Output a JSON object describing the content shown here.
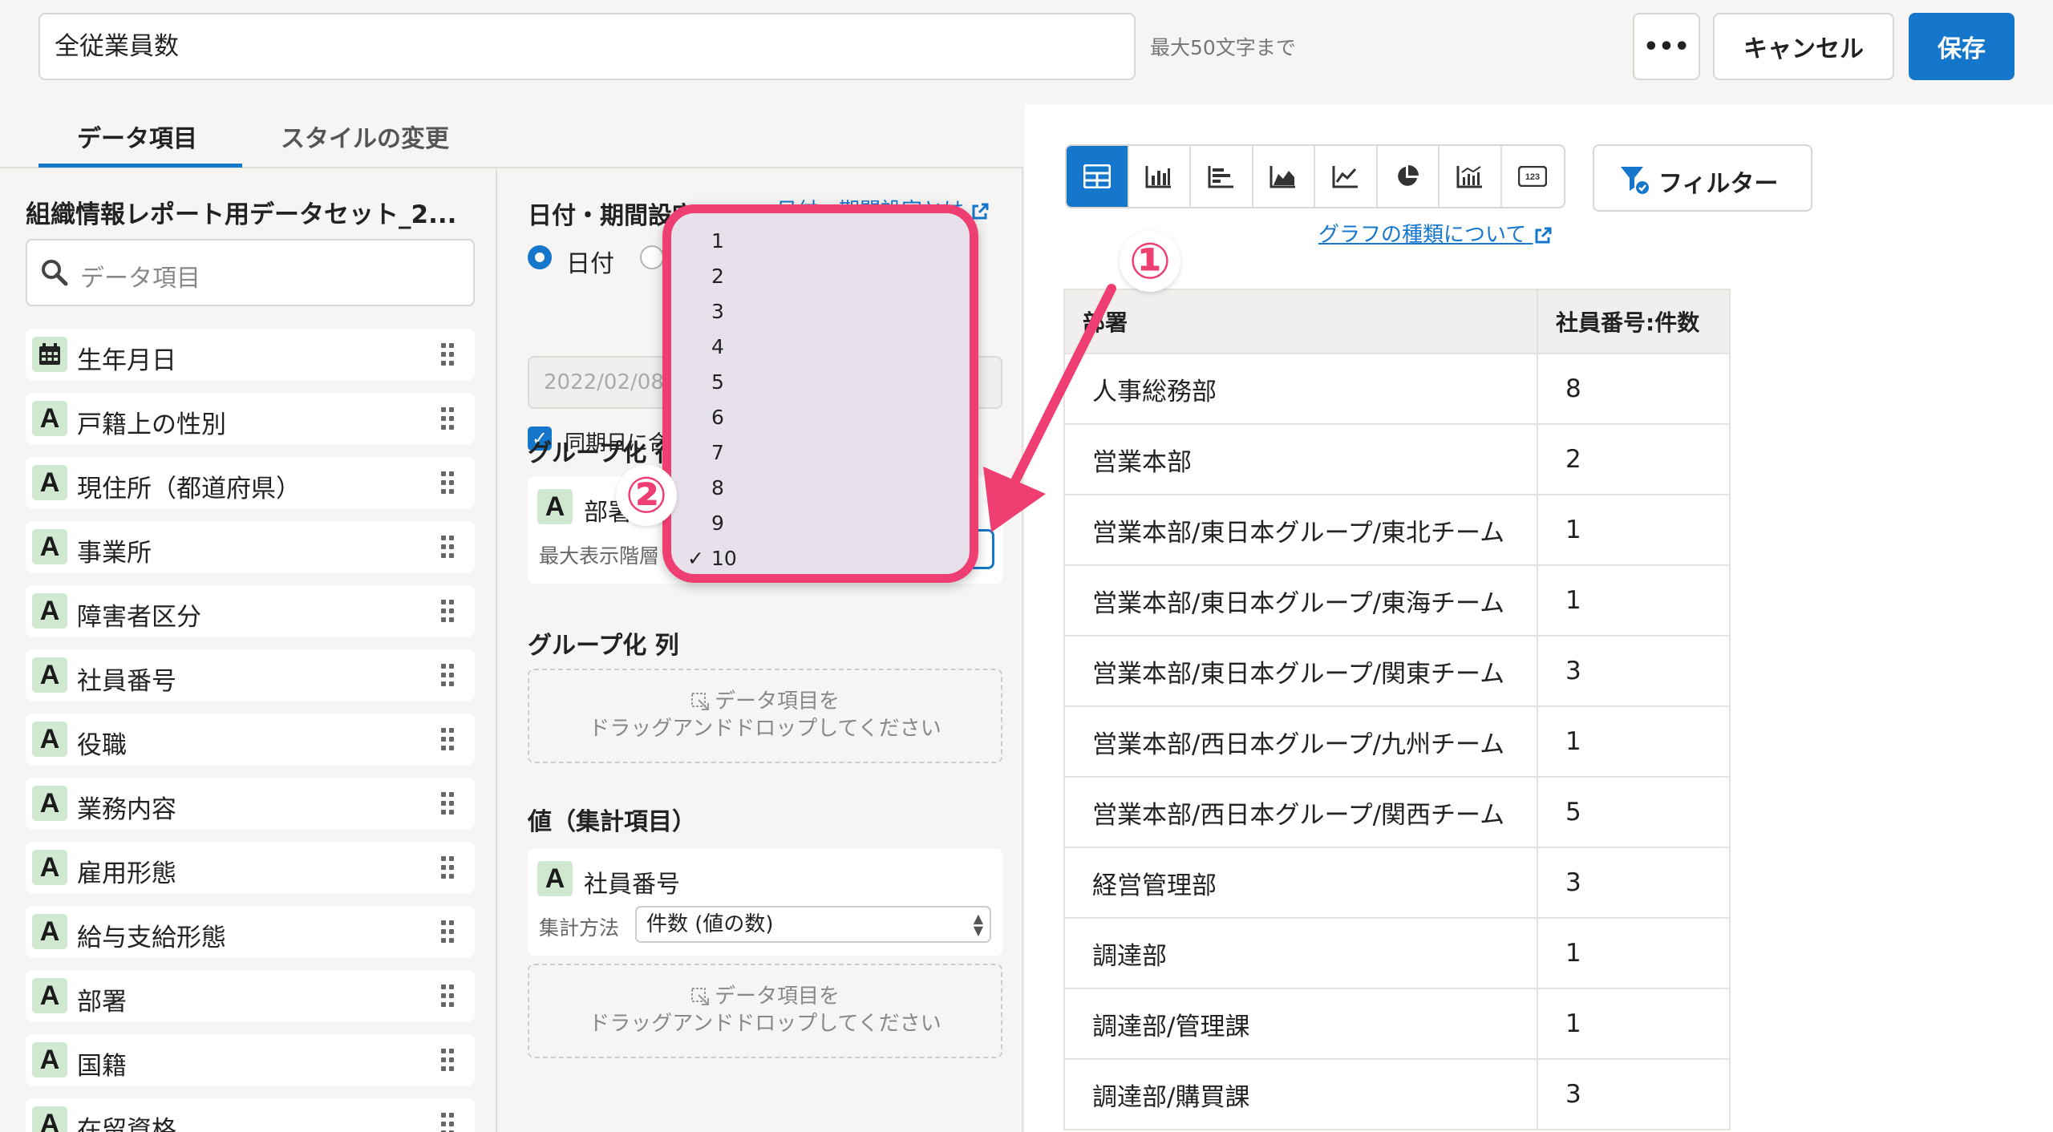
{
  "header": {
    "report_name": "全従業員数",
    "name_hint": "最大50文字まで",
    "more_label": "•••",
    "cancel_label": "キャンセル",
    "save_label": "保存"
  },
  "tabs": [
    {
      "label": "データ項目",
      "active": true
    },
    {
      "label": "スタイルの変更",
      "active": false
    }
  ],
  "data_panel": {
    "dataset_title": "組織情報レポート用データセット_2...",
    "search_placeholder": "データ項目",
    "items": [
      {
        "type": "date",
        "label": "生年月日"
      },
      {
        "type": "A",
        "label": "戸籍上の性別"
      },
      {
        "type": "A",
        "label": "現住所（都道府県）"
      },
      {
        "type": "A",
        "label": "事業所"
      },
      {
        "type": "A",
        "label": "障害者区分"
      },
      {
        "type": "A",
        "label": "社員番号"
      },
      {
        "type": "A",
        "label": "役職"
      },
      {
        "type": "A",
        "label": "業務内容"
      },
      {
        "type": "A",
        "label": "雇用形態"
      },
      {
        "type": "A",
        "label": "給与支給形態"
      },
      {
        "type": "A",
        "label": "部署"
      },
      {
        "type": "A",
        "label": "国籍"
      },
      {
        "type": "A",
        "label": "在留資格"
      }
    ]
  },
  "settings": {
    "date_section_title": "日付・期間設定",
    "date_help_link": "日付・期間設定とは",
    "radio_date_label": "日付",
    "date_value": "2022/02/08",
    "same_day_label": "同期日に合",
    "group_row_title": "グループ化 行",
    "group_row_item": "部署",
    "group_row_sub": "最大表示階層",
    "group_col_title": "グループ化 列",
    "dropzone_line1": "データ項目を",
    "dropzone_line2": "ドラッグアンドドロップしてください",
    "values_title": "値（集計項目）",
    "values_item": "社員番号",
    "agg_label": "集計方法",
    "agg_value": "件数 (値の数)"
  },
  "level_dropdown": {
    "options": [
      "1",
      "2",
      "3",
      "4",
      "5",
      "6",
      "7",
      "8",
      "9",
      "10"
    ],
    "selected": "10",
    "check_mark": "✓"
  },
  "chart_types": [
    "table-icon",
    "bar-chart-icon",
    "horizontal-bar-icon",
    "area-chart-icon",
    "line-chart-icon",
    "pie-chart-icon",
    "combo-chart-icon",
    "number-icon"
  ],
  "filter_label": "フィルター",
  "graph_link": "グラフの種類について",
  "annotations": {
    "badge1": "①",
    "badge2": "②"
  },
  "table": {
    "headers": [
      "部署",
      "社員番号:件数"
    ],
    "rows": [
      [
        "人事総務部",
        "8"
      ],
      [
        "営業本部",
        "2"
      ],
      [
        "営業本部/東日本グループ/東北チーム",
        "1"
      ],
      [
        "営業本部/東日本グループ/東海チーム",
        "1"
      ],
      [
        "営業本部/東日本グループ/関東チーム",
        "3"
      ],
      [
        "営業本部/西日本グループ/九州チーム",
        "1"
      ],
      [
        "営業本部/西日本グループ/関西チーム",
        "5"
      ],
      [
        "経営管理部",
        "3"
      ],
      [
        "調達部",
        "1"
      ],
      [
        "調達部/管理課",
        "1"
      ],
      [
        "調達部/購買課",
        "3"
      ]
    ]
  },
  "colors": {
    "accent": "#1577cc",
    "annotation": "#ee3e72",
    "type_badge": "#cfe8cf"
  }
}
